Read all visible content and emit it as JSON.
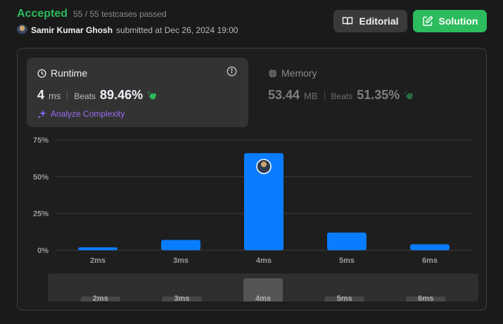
{
  "header": {
    "status": "Accepted",
    "testcases": "55 / 55 testcases passed",
    "user": "Samir Kumar Ghosh",
    "submitted_text": "submitted at Dec 26, 2024 19:00"
  },
  "buttons": {
    "editorial_label": "Editorial",
    "solution_label": "Solution"
  },
  "runtime": {
    "title": "Runtime",
    "value": "4",
    "unit": "ms",
    "beats_label": "Beats",
    "beats": "89.46%",
    "analyze_label": "Analyze Complexity"
  },
  "memory": {
    "title": "Memory",
    "value": "53.44",
    "unit": "MB",
    "beats_label": "Beats",
    "beats": "51.35%"
  },
  "colors": {
    "accepted": "#2cbb5d",
    "bar": "#0a7cff",
    "analyze": "#9b6cf0"
  },
  "chart_data": {
    "type": "bar",
    "categories": [
      "2ms",
      "3ms",
      "4ms",
      "5ms",
      "6ms"
    ],
    "values": [
      2,
      7,
      66,
      12,
      4
    ],
    "ylim": [
      0,
      75
    ],
    "yticks": [
      "0%",
      "25%",
      "50%",
      "75%"
    ],
    "ytick_values": [
      0,
      25,
      50,
      75
    ],
    "highlight_category": "4ms",
    "grid": true
  },
  "range_selector": {
    "categories": [
      "2ms",
      "3ms",
      "4ms",
      "5ms",
      "6ms"
    ],
    "selected": "4ms"
  }
}
